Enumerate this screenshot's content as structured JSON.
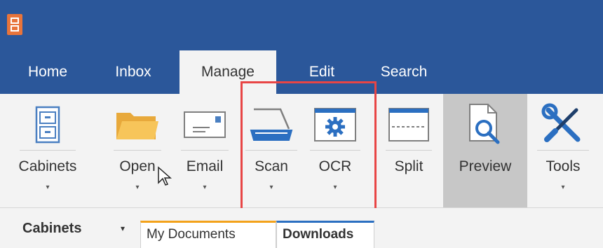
{
  "tabs": [
    {
      "label": "Home"
    },
    {
      "label": "Inbox"
    },
    {
      "label": "Manage"
    },
    {
      "label": "Edit"
    },
    {
      "label": "Search"
    }
  ],
  "active_tab": "Manage",
  "ribbon": {
    "cabinets": {
      "label": "Cabinets",
      "icon": "cabinet-icon"
    },
    "open": {
      "label": "Open",
      "icon": "folder-icon"
    },
    "email": {
      "label": "Email",
      "icon": "envelope-icon"
    },
    "scan": {
      "label": "Scan",
      "icon": "scanner-icon"
    },
    "ocr": {
      "label": "OCR",
      "icon": "gear-window-icon"
    },
    "split": {
      "label": "Split",
      "icon": "split-page-icon"
    },
    "preview": {
      "label": "Preview",
      "icon": "magnify-document-icon"
    },
    "tools": {
      "label": "Tools",
      "icon": "wrench-screwdriver-icon"
    }
  },
  "dropdown_arrow": "▾",
  "cabinet_bar": {
    "label": "Cabinets",
    "dropdown_arrow": "▾",
    "tabs": [
      {
        "label": "My Documents",
        "color": "#f3a21b"
      },
      {
        "label": "Downloads",
        "color": "#2b6fc1"
      }
    ]
  },
  "colors": {
    "title_bar": "#2b579a",
    "highlight": "#e84545",
    "ribbon_bg": "#f3f3f3"
  }
}
